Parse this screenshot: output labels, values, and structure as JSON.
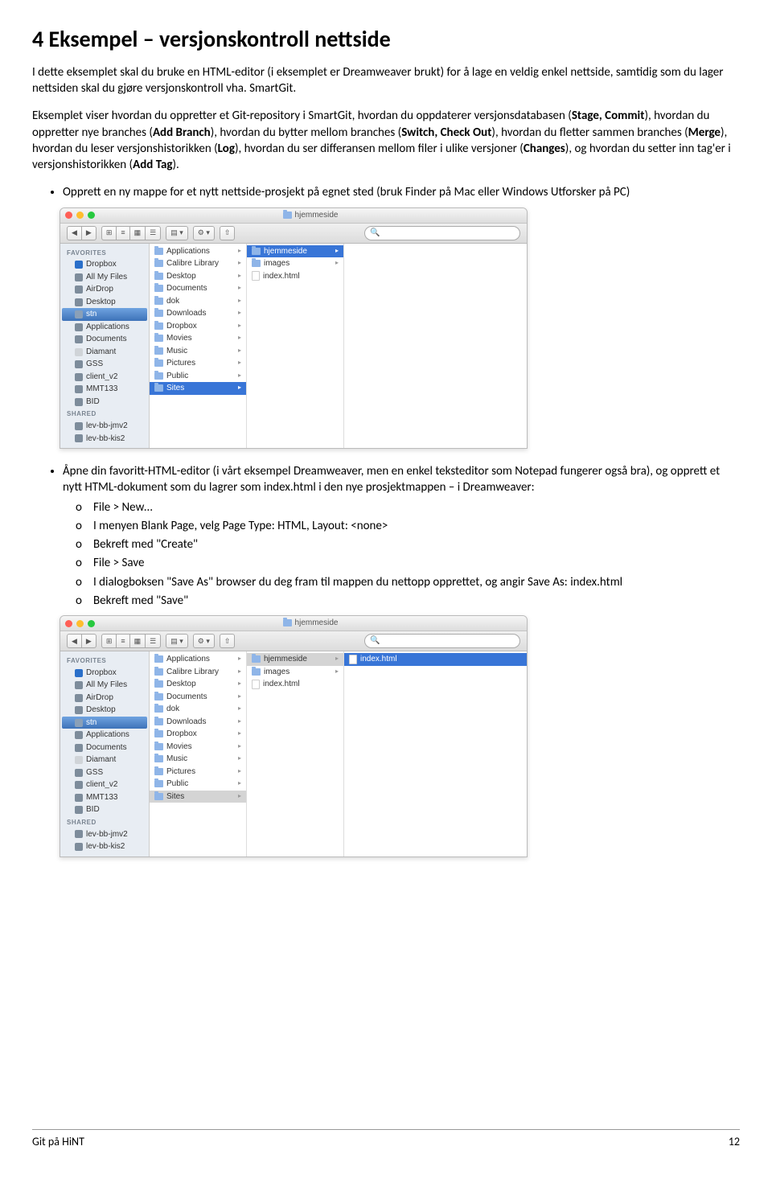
{
  "heading": "4 Eksempel – versjonskontroll nettside",
  "para1": "I dette eksemplet skal du bruke en HTML-editor (i eksemplet er Dreamweaver brukt) for å lage en veldig enkel nettside, samtidig som du lager nettsiden skal du gjøre versjonskontroll vha. SmartGit.",
  "para2a": "Eksemplet viser hvordan du oppretter et Git-repository i SmartGit, hvordan du oppdaterer versjonsdatabasen (",
  "para2b": "), hvordan du oppretter nye branches (",
  "para2c": "), hvordan du bytter mellom branches (",
  "para2d": "), hvordan du fletter sammen branches (",
  "para2e": "), hvordan du leser versjonshistorikken (",
  "para2f": "), hvordan du ser differansen mellom filer i ulike versjoner (",
  "para2g": "), og hvordan du setter inn tag'er i versjonshistorikken (",
  "para2h": ").",
  "bold": {
    "stage": "Stage, Commit",
    "add": "Add Branch",
    "switch": "Switch, Check Out",
    "merge": "Merge",
    "log": "Log",
    "changes": "Changes",
    "tag": "Add Tag"
  },
  "bullet1": "Opprett en ny mappe for et nytt nettside-prosjekt på egnet sted (bruk Finder på Mac eller Windows Utforsker på PC)",
  "bullet2": "Åpne din favoritt-HTML-editor (i vårt eksempel Dreamweaver, men en enkel teksteditor som Notepad fungerer også bra), og opprett et nytt HTML-dokument som du lagrer som index.html i den nye prosjektmappen – i Dreamweaver:",
  "sub": {
    "a": "File > New…",
    "b": "I menyen Blank Page, velg Page Type: HTML, Layout: <none>",
    "c": "Bekreft med \"Create\"",
    "d": "File > Save",
    "e": "I dialogboksen \"Save As\" browser du deg fram til mappen du nettopp opprettet, og angir Save As: index.html",
    "f": "Bekreft med \"Save\""
  },
  "finder": {
    "title": "hjemmeside",
    "side_fav": "FAVORITES",
    "side_shared": "SHARED",
    "favs": [
      "Dropbox",
      "All My Files",
      "AirDrop",
      "Desktop",
      "stn",
      "Applications",
      "Documents",
      "Diamant",
      "GSS",
      "client_v2",
      "MMT133",
      "BID"
    ],
    "shared": [
      "lev-bb-jmv2",
      "lev-bb-kis2"
    ],
    "col1": [
      "Applications",
      "Calibre Library",
      "Desktop",
      "Documents",
      "dok",
      "Downloads",
      "Dropbox",
      "Movies",
      "Music",
      "Pictures",
      "Public",
      "Sites"
    ],
    "col2": [
      "hjemmeside",
      "images",
      "index.html"
    ],
    "col3": [
      "index.html"
    ]
  },
  "footer_left": "Git på HiNT",
  "footer_right": "12"
}
